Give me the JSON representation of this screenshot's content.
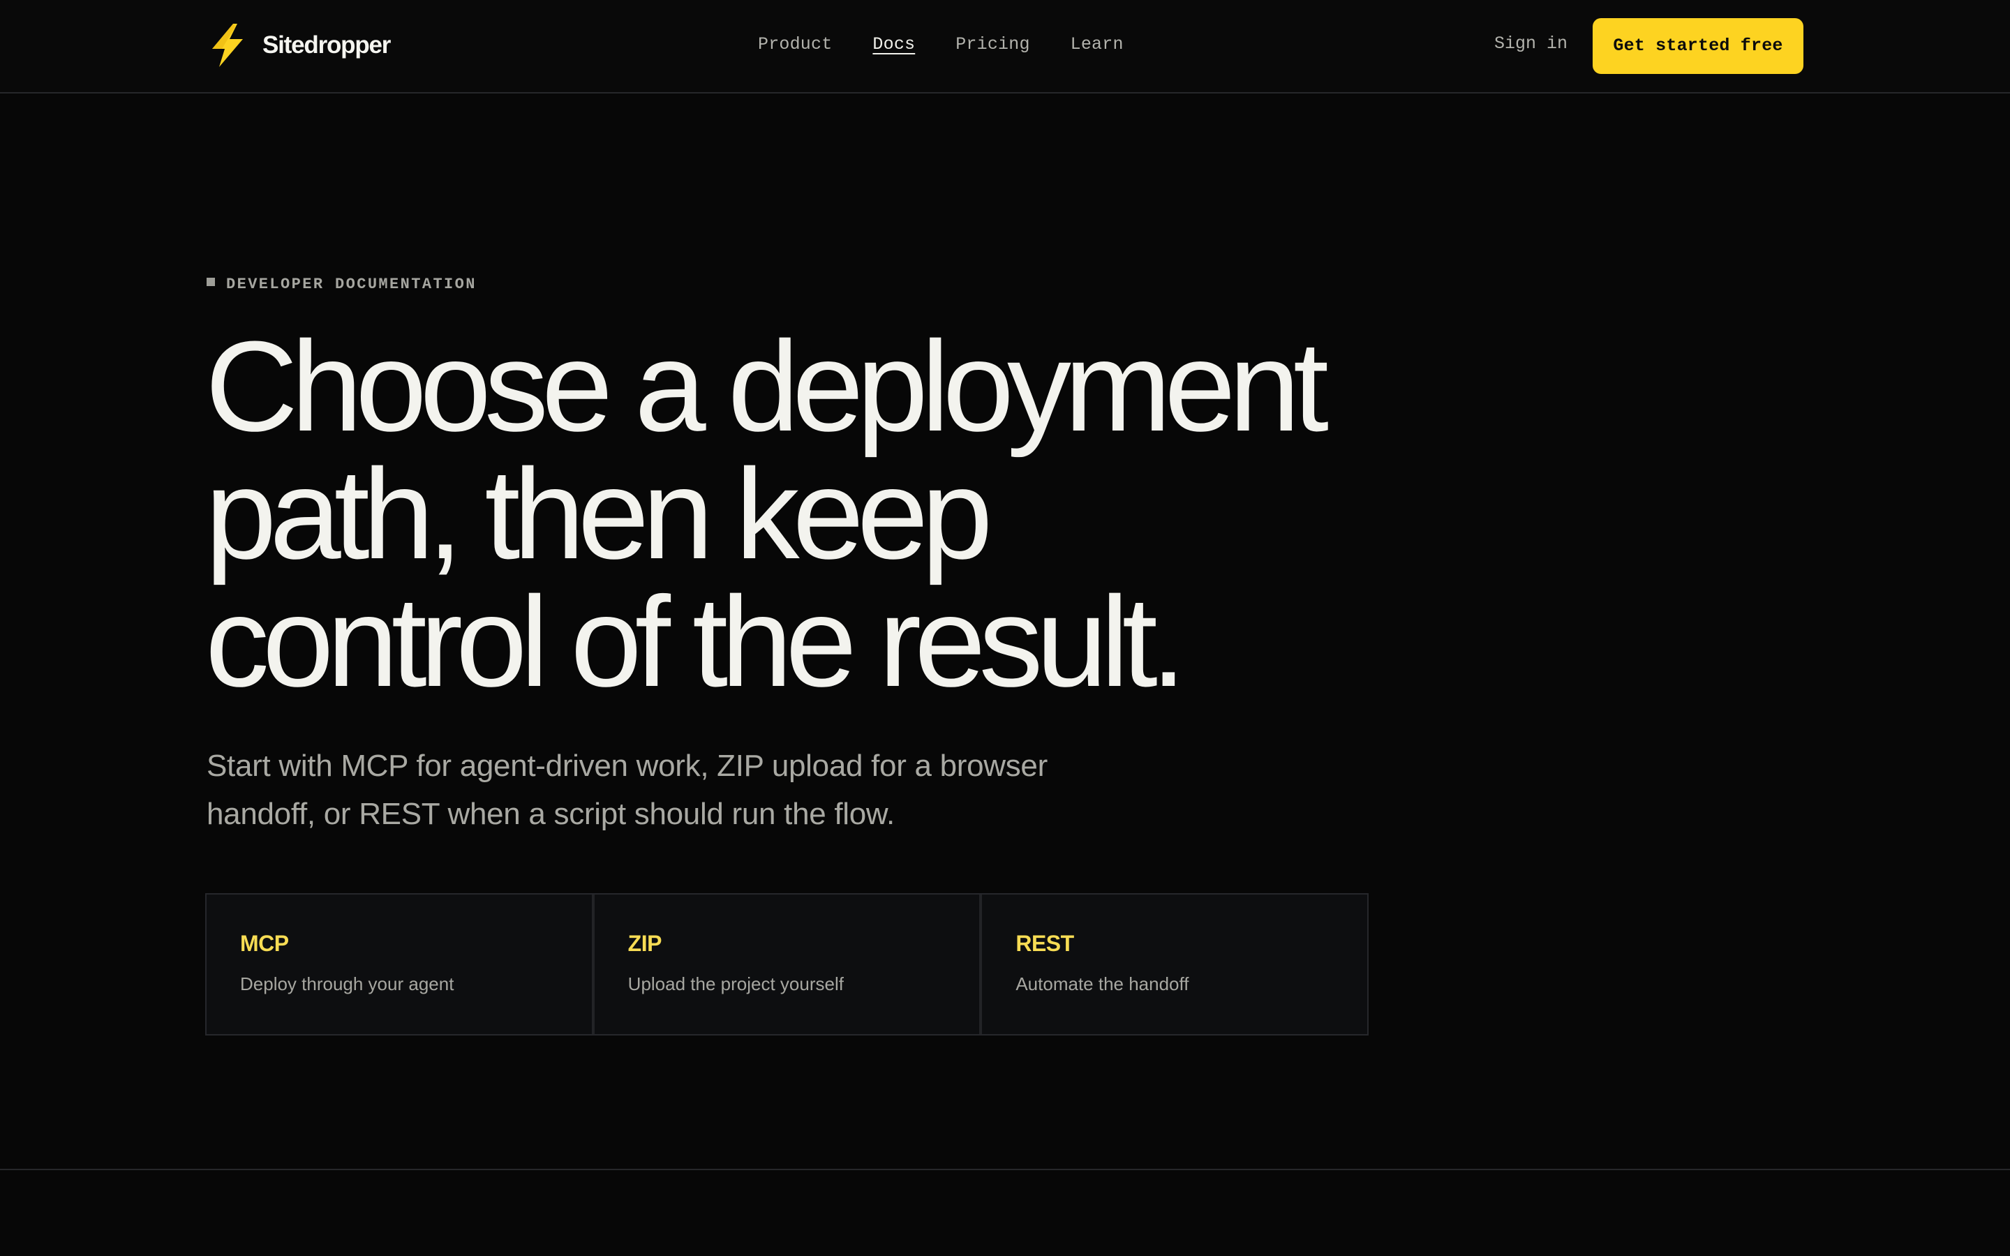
{
  "colors": {
    "accent": "#fdd321",
    "background": "#070707",
    "card_title": "#f7dc54"
  },
  "brand": {
    "name": "Sitedropper",
    "icon": "lightning-bolt-icon"
  },
  "nav": {
    "items": [
      {
        "label": "Product",
        "active": false
      },
      {
        "label": "Docs",
        "active": true
      },
      {
        "label": "Pricing",
        "active": false
      },
      {
        "label": "Learn",
        "active": false
      }
    ]
  },
  "header": {
    "sign_in_label": "Sign in",
    "cta_label": "Get started free"
  },
  "hero": {
    "eyebrow": "DEVELOPER DOCUMENTATION",
    "headline_lines": [
      "Choose a deployment",
      "path, then keep",
      "control of the result."
    ],
    "lede": "Start with MCP for agent-driven work, ZIP upload for a browser handoff, or REST when a script should run the flow."
  },
  "cards": [
    {
      "title": "MCP",
      "description": "Deploy through your agent"
    },
    {
      "title": "ZIP",
      "description": "Upload the project yourself"
    },
    {
      "title": "REST",
      "description": "Automate the handoff"
    }
  ]
}
